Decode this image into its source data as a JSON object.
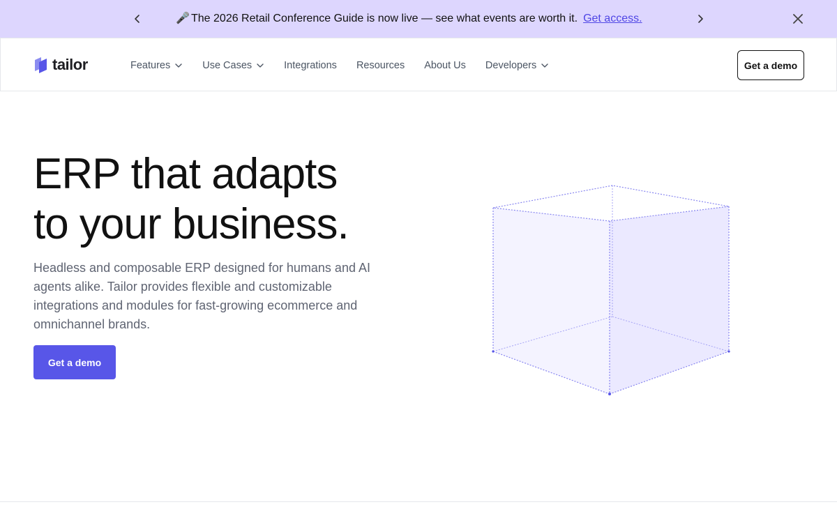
{
  "announcement": {
    "icon": "microphone-icon",
    "mic_glyph": "🎤",
    "message": "The 2026 Retail Conference Guide is now live — see what events are worth it.",
    "link_label": "Get access.",
    "background": "#ddd6fe",
    "link_color": "#4f46e5"
  },
  "nav": {
    "logo_text": "tailor",
    "items": [
      {
        "label": "Features",
        "has_dropdown": true
      },
      {
        "label": "Use Cases",
        "has_dropdown": true
      },
      {
        "label": "Integrations",
        "has_dropdown": false
      },
      {
        "label": "Resources",
        "has_dropdown": false
      },
      {
        "label": "About Us",
        "has_dropdown": false
      },
      {
        "label": "Developers",
        "has_dropdown": true
      }
    ],
    "cta_label": "Get a demo"
  },
  "hero": {
    "title_line1": "ERP that adapts",
    "title_line2": "to your business.",
    "subtitle": "Headless and composable ERP designed for humans and AI agents alike. Tailor provides flexible and customizable integrations and modules for fast-growing ecommerce and omnichannel brands.",
    "cta_label": "Get a demo",
    "accent": "#5856e8"
  }
}
